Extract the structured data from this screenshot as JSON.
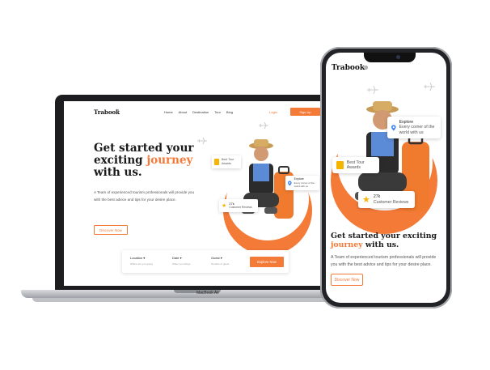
{
  "laptop": {
    "brand_label": "MacBook Air",
    "logo": "Trabook",
    "nav_links": [
      "Home",
      "About",
      "Destination",
      "Tour",
      "Blog"
    ],
    "login": "Login",
    "signup": "Sign Up",
    "heading_part1": "Get started your exciting ",
    "heading_accent": "journey",
    "heading_part2": " with us.",
    "paragraph": "A Team of experienced tourism professionals will provide you with the best advice and tips for your desire place.",
    "discover_button": "Discover Now",
    "awards_card": "Best Tour Awards",
    "explore_card_title": "Explore",
    "explore_card_text": "Every corner of the world with us",
    "reviews_count": "27k",
    "reviews_label": "Customer Reviews",
    "search": {
      "location_label": "Location",
      "location_sub": "Where are you going",
      "date_label": "Date",
      "date_sub": "When you will go",
      "guest_label": "Guest",
      "guest_sub": "Number of guest",
      "explore_button": "Explore Now"
    }
  },
  "phone": {
    "logo": "Trabook",
    "explore_card_title": "Explore",
    "explore_card_text": "Every corner of the world with us",
    "awards_card": "Best Tour Awards",
    "reviews_count": "27k",
    "reviews_label": "Customer Reviews",
    "heading_part1": "Get started your exciting ",
    "heading_accent": "journey",
    "heading_part2": " with us.",
    "paragraph": "A Team of experienced tourism professionals will provide you with the best advice and tips for your desire place.",
    "discover_button": "Discover Now"
  },
  "colors": {
    "accent": "#f47a38",
    "star": "#f5b400",
    "device": "#1d1d1f"
  }
}
